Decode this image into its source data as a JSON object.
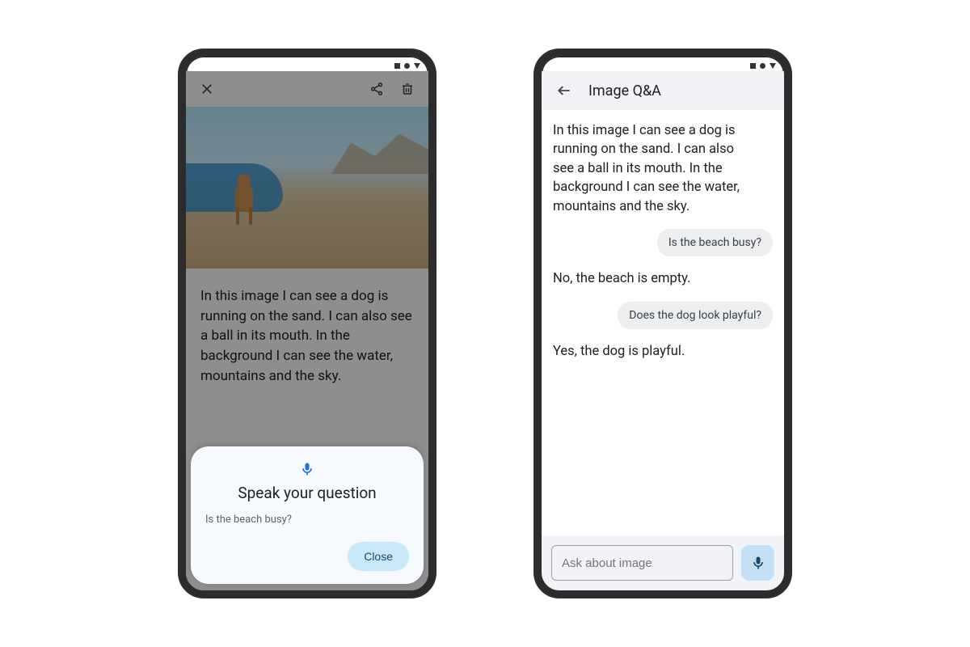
{
  "phone1": {
    "caption": "In this image I can see a dog is running on the sand. I can also see a ball in its mouth. In the background I can see the water, mountains and the sky.",
    "sheet": {
      "title": "Speak your question",
      "transcript": "Is the beach busy?",
      "close_label": "Close"
    }
  },
  "phone2": {
    "header_title": "Image Q&A",
    "messages": {
      "ai1": "In this image I can see a dog is running on the sand. I can also see a ball in its mouth. In the background I can see the water, mountains and the sky.",
      "user1": "Is the beach busy?",
      "ai2": "No, the beach is empty.",
      "user2": "Does the dog look playful?",
      "ai3": "Yes, the dog is playful."
    },
    "input_placeholder": "Ask about image"
  }
}
